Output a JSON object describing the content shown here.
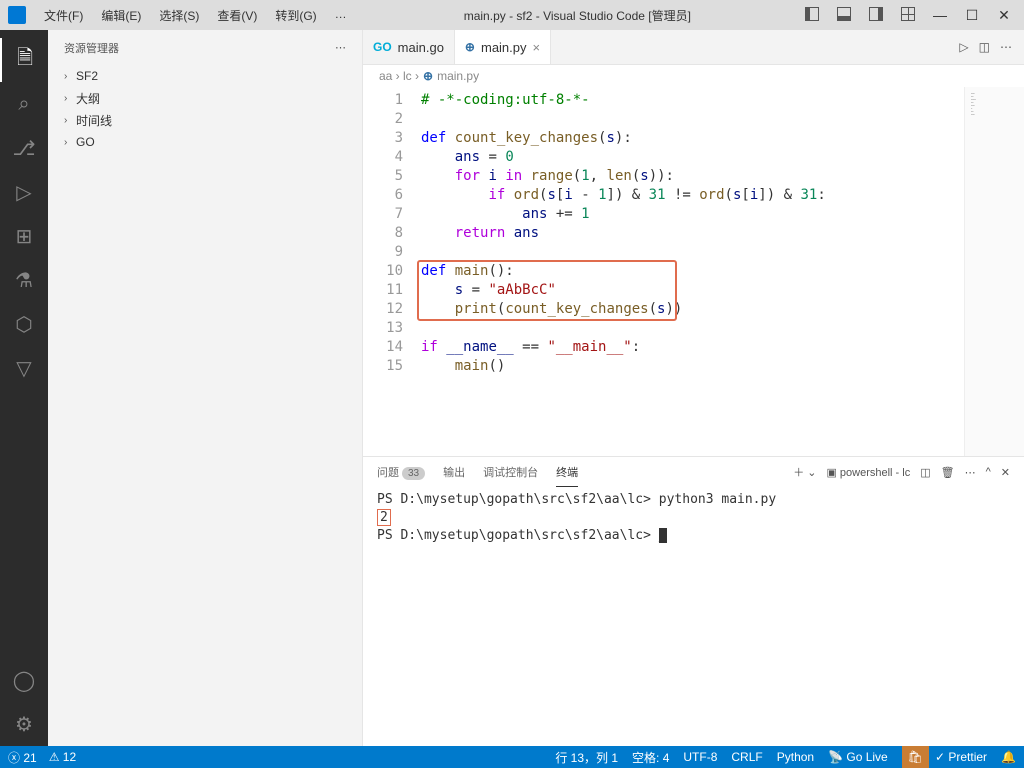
{
  "titlebar": {
    "menus": [
      "文件(F)",
      "编辑(E)",
      "选择(S)",
      "查看(V)",
      "转到(G)",
      "…"
    ],
    "title": "main.py - sf2 - Visual Studio Code [管理员]"
  },
  "sidebar": {
    "header": "资源管理器",
    "items": [
      "SF2",
      "大纲",
      "时间线",
      "GO"
    ]
  },
  "tabs": {
    "items": [
      {
        "icon": "Go",
        "label": "main.go",
        "active": false
      },
      {
        "icon": "py",
        "label": "main.py",
        "active": true
      }
    ]
  },
  "breadcrumb": [
    "aa",
    "lc",
    "main.py"
  ],
  "editor": {
    "lines": [
      {
        "n": 1,
        "html": "<span class='cmt'># -*-coding:utf-8-*-</span>"
      },
      {
        "n": 2,
        "html": ""
      },
      {
        "n": 3,
        "html": "<span class='kw'>def</span> <span class='fn'>count_key_changes</span>(<span class='var'>s</span>):"
      },
      {
        "n": 4,
        "html": "    <span class='var'>ans</span> = <span class='num'>0</span>"
      },
      {
        "n": 5,
        "html": "    <span class='ctl'>for</span> <span class='var'>i</span> <span class='ctl'>in</span> <span class='fn'>range</span>(<span class='num'>1</span>, <span class='fn'>len</span>(<span class='var'>s</span>)):"
      },
      {
        "n": 6,
        "html": "        <span class='ctl'>if</span> <span class='fn'>ord</span>(<span class='var'>s</span>[<span class='var'>i</span> - <span class='num'>1</span>]) &amp; <span class='num'>31</span> != <span class='fn'>ord</span>(<span class='var'>s</span>[<span class='var'>i</span>]) &amp; <span class='num'>31</span>:"
      },
      {
        "n": 7,
        "html": "            <span class='var'>ans</span> += <span class='num'>1</span>"
      },
      {
        "n": 8,
        "html": "    <span class='ctl'>return</span> <span class='var'>ans</span>"
      },
      {
        "n": 9,
        "html": ""
      },
      {
        "n": 10,
        "html": "<span class='kw'>def</span> <span class='fn'>main</span>():"
      },
      {
        "n": 11,
        "html": "    <span class='var'>s</span> = <span class='str'>\"aAbBcC\"</span>"
      },
      {
        "n": 12,
        "html": "    <span class='fn'>print</span>(<span class='fn'>count_key_changes</span>(<span class='var'>s</span>))"
      },
      {
        "n": 13,
        "html": ""
      },
      {
        "n": 14,
        "html": "<span class='ctl'>if</span> <span class='var'>__name__</span> == <span class='str'>\"__main__\"</span>:"
      },
      {
        "n": 15,
        "html": "    <span class='fn'>main</span>()"
      }
    ]
  },
  "panel": {
    "tabs": {
      "problems": "问题",
      "problems_count": "33",
      "output": "输出",
      "debug": "调试控制台",
      "terminal": "终端"
    },
    "terminal_label": "powershell - lc",
    "terminal": [
      "PS D:\\mysetup\\gopath\\src\\sf2\\aa\\lc> python3 main.py",
      "2",
      "PS D:\\mysetup\\gopath\\src\\sf2\\aa\\lc> "
    ]
  },
  "statusbar": {
    "errors": "21",
    "warnings": "12",
    "cursor": "行 13，列 1",
    "spaces": "空格: 4",
    "encoding": "UTF-8",
    "eol": "CRLF",
    "lang": "Python",
    "golive": "Go Live",
    "prettier": "Prettier"
  }
}
